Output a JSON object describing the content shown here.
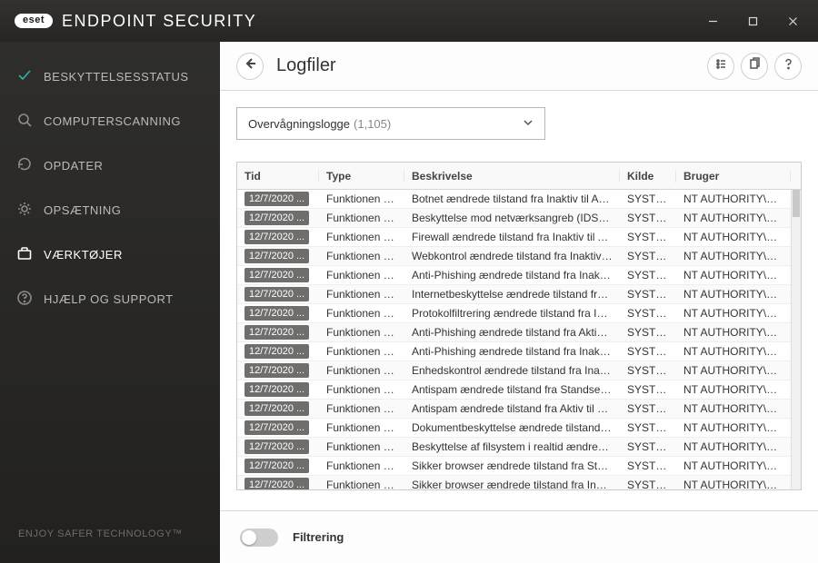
{
  "app": {
    "brand_short": "eset",
    "product": "ENDPOINT SECURITY",
    "tagline": "ENJOY SAFER TECHNOLOGY™"
  },
  "nav": {
    "items": [
      {
        "id": "protection-status",
        "label": "BESKYTTELSESSTATUS"
      },
      {
        "id": "computer-scan",
        "label": "COMPUTERSCANNING"
      },
      {
        "id": "update",
        "label": "OPDATER"
      },
      {
        "id": "settings",
        "label": "OPSÆTNING"
      },
      {
        "id": "tools",
        "label": "VÆRKTØJER"
      },
      {
        "id": "help",
        "label": "HJÆLP OG SUPPORT"
      }
    ]
  },
  "page": {
    "title": "Logfiler",
    "log_select": {
      "name": "Overvågningslogge",
      "count": "(1,105)"
    },
    "columns": {
      "tid": "Tid",
      "type": "Type",
      "beskrivelse": "Beskrivelse",
      "kilde": "Kilde",
      "bruger": "Bruger"
    },
    "rows": [
      {
        "tid": "12/7/2020 ...",
        "type": "Funktionen er ...",
        "beskrivelse": "Botnet ændrede tilstand fra Inaktiv til Aktiv",
        "kilde": "SYSTEM",
        "bruger": "NT AUTHORITY\\SYSTEM"
      },
      {
        "tid": "12/7/2020 ...",
        "type": "Funktionen er ...",
        "beskrivelse": "Beskyttelse mod netværksangreb (IDS) ændre...",
        "kilde": "SYSTEM",
        "bruger": "NT AUTHORITY\\SYSTEM"
      },
      {
        "tid": "12/7/2020 ...",
        "type": "Funktionen er ...",
        "beskrivelse": "Firewall ændrede tilstand fra Inaktiv til Aktiv",
        "kilde": "SYSTEM",
        "bruger": "NT AUTHORITY\\SYSTEM"
      },
      {
        "tid": "12/7/2020 ...",
        "type": "Funktionen er ...",
        "beskrivelse": "Webkontrol ændrede tilstand fra Inaktiv til A...",
        "kilde": "SYSTEM",
        "bruger": "NT AUTHORITY\\SYSTEM"
      },
      {
        "tid": "12/7/2020 ...",
        "type": "Funktionen er ...",
        "beskrivelse": "Anti-Phishing ændrede tilstand fra Inaktiv til ...",
        "kilde": "SYSTEM",
        "bruger": "NT AUTHORITY\\SYSTEM"
      },
      {
        "tid": "12/7/2020 ...",
        "type": "Funktionen er ...",
        "beskrivelse": "Internetbeskyttelse ændrede tilstand fra Inakt...",
        "kilde": "SYSTEM",
        "bruger": "NT AUTHORITY\\SYSTEM"
      },
      {
        "tid": "12/7/2020 ...",
        "type": "Funktionen er ...",
        "beskrivelse": "Protokolfiltrering ændrede tilstand fra Inaktiv...",
        "kilde": "SYSTEM",
        "bruger": "NT AUTHORITY\\SYSTEM"
      },
      {
        "tid": "12/7/2020 ...",
        "type": "Funktionen er ...",
        "beskrivelse": "Anti-Phishing ændrede tilstand fra Aktiv til In...",
        "kilde": "SYSTEM",
        "bruger": "NT AUTHORITY\\SYSTEM"
      },
      {
        "tid": "12/7/2020 ...",
        "type": "Funktionen er ...",
        "beskrivelse": "Anti-Phishing ændrede tilstand fra Inaktiv til ...",
        "kilde": "SYSTEM",
        "bruger": "NT AUTHORITY\\SYSTEM"
      },
      {
        "tid": "12/7/2020 ...",
        "type": "Funktionen er ...",
        "beskrivelse": "Enhedskontrol ændrede tilstand fra Inaktiv til...",
        "kilde": "SYSTEM",
        "bruger": "NT AUTHORITY\\SYSTEM"
      },
      {
        "tid": "12/7/2020 ...",
        "type": "Funktionen er ...",
        "beskrivelse": "Antispam ændrede tilstand fra Standset midle...",
        "kilde": "SYSTEM",
        "bruger": "NT AUTHORITY\\SYSTEM"
      },
      {
        "tid": "12/7/2020 ...",
        "type": "Funktionen er ...",
        "beskrivelse": "Antispam ændrede tilstand fra Aktiv til Stands...",
        "kilde": "SYSTEM",
        "bruger": "NT AUTHORITY\\SYSTEM"
      },
      {
        "tid": "12/7/2020 ...",
        "type": "Funktionen er ...",
        "beskrivelse": "Dokumentbeskyttelse ændrede tilstand fra In...",
        "kilde": "SYSTEM",
        "bruger": "NT AUTHORITY\\SYSTEM"
      },
      {
        "tid": "12/7/2020 ...",
        "type": "Funktionen er ...",
        "beskrivelse": "Beskyttelse af filsystem i realtid ændrede tilsta...",
        "kilde": "SYSTEM",
        "bruger": "NT AUTHORITY\\SYSTEM"
      },
      {
        "tid": "12/7/2020 ...",
        "type": "Funktionen er ...",
        "beskrivelse": "Sikker browser ændrede tilstand fra Standset ...",
        "kilde": "SYSTEM",
        "bruger": "NT AUTHORITY\\SYSTEM"
      },
      {
        "tid": "12/7/2020 ...",
        "type": "Funktionen er ...",
        "beskrivelse": "Sikker browser ændrede tilstand fra Inaktiv til...",
        "kilde": "SYSTEM",
        "bruger": "NT AUTHORITY\\SYSTEM"
      }
    ],
    "footer": {
      "filtering": "Filtrering"
    }
  }
}
